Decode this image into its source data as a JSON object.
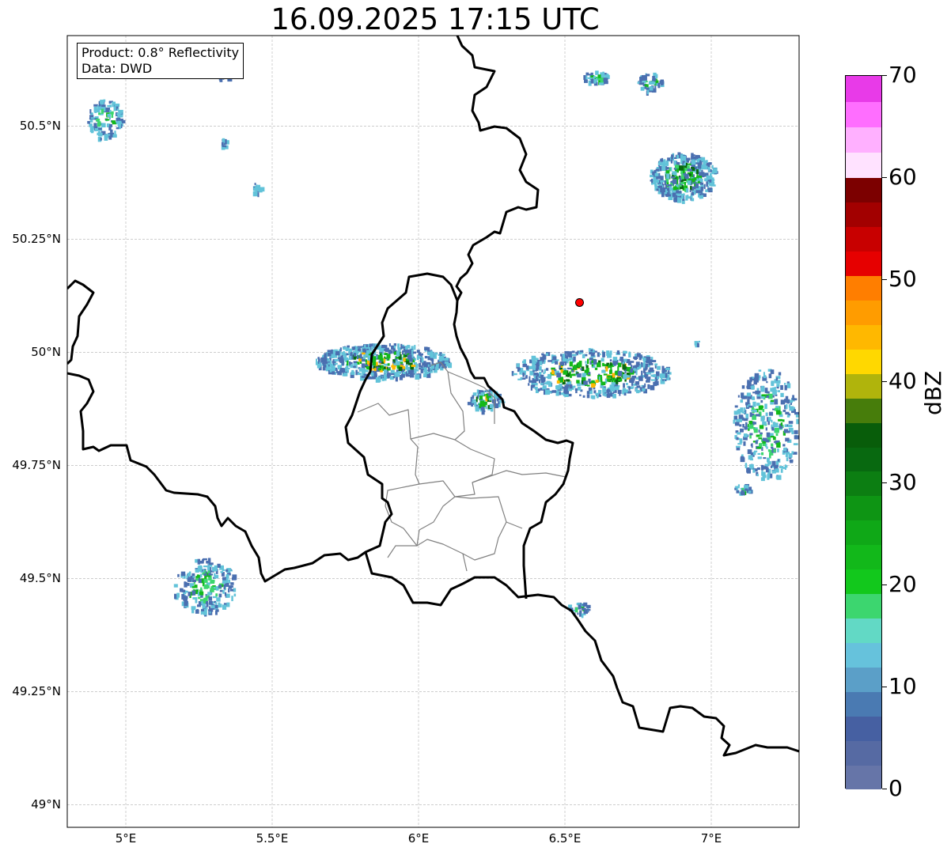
{
  "title": "16.09.2025 17:15 UTC",
  "info_box": {
    "product": "Product: 0.8° Reflectivity",
    "source": "Data: DWD"
  },
  "map": {
    "lon_range": [
      4.8,
      7.3
    ],
    "lat_range": [
      48.95,
      50.7
    ],
    "x_ticks": [
      "5°E",
      "5.5°E",
      "6°E",
      "6.5°E",
      "7°E"
    ],
    "y_ticks": [
      "50.5°N",
      "50.25°N",
      "50°N",
      "49.75°N",
      "49.5°N",
      "49.25°N",
      "49°N"
    ],
    "gridlines": true,
    "marker": {
      "lon": 6.55,
      "lat": 50.11,
      "color": "#ff0000",
      "label": ""
    },
    "border_color": "#000000",
    "admin_border_color": "#808080"
  },
  "colorbar": {
    "unit": "dBZ",
    "range": [
      0,
      70
    ],
    "tick_labels": [
      "70",
      "60",
      "50",
      "40",
      "30",
      "20",
      "10",
      "0"
    ],
    "tick_values": [
      70,
      60,
      50,
      40,
      30,
      20,
      10,
      0
    ],
    "colors": [
      "#6675a8",
      "#566aa3",
      "#4660a2",
      "#4a7ab2",
      "#5b9fc8",
      "#66c2dc",
      "#62d9c5",
      "#3cd66f",
      "#12c81c",
      "#12b81a",
      "#0fa817",
      "#0e9514",
      "#0c7e12",
      "#086910",
      "#085d0a",
      "#477d0b",
      "#b0b40c",
      "#ffd800",
      "#ffb800",
      "#ff9c00",
      "#ff7e00",
      "#e60000",
      "#c80000",
      "#a20000",
      "#7c0000",
      "#ffe2ff",
      "#ffb0ff",
      "#ff6eff",
      "#e83ae8"
    ]
  },
  "echo_colors": {
    "weak": "#4a6fb0",
    "light": "#62c3d9",
    "medium": "#3cd66f",
    "moderate": "#13b81a",
    "strong": "#086910",
    "intense": "#ffb800"
  }
}
